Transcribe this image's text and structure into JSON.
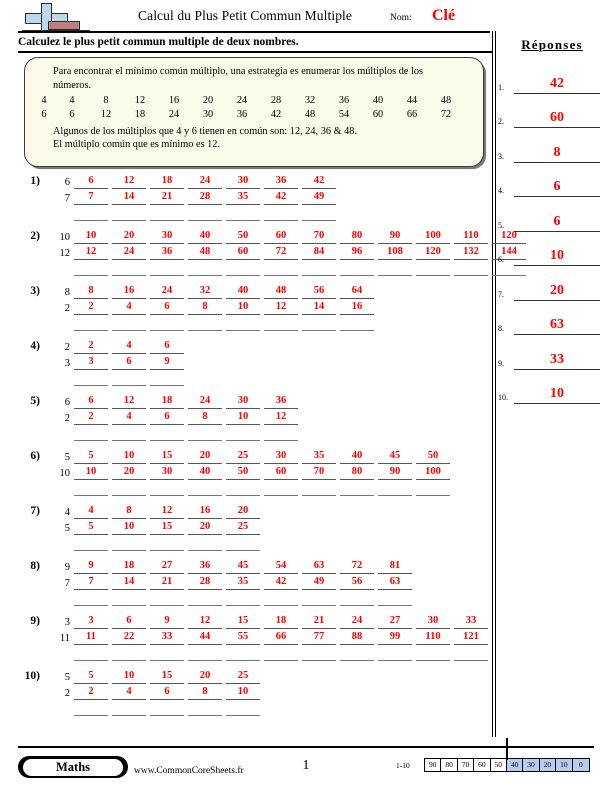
{
  "header": {
    "title": "Calcul du Plus Petit Commun Multiple",
    "name_label": "Nom:",
    "name_value": "Clé",
    "logo_icon": "plus-book-logo"
  },
  "instruction": "Calculez le plus petit commun multiple de deux nombres.",
  "example": {
    "line1": "Para encontrar el mínimo común múltiplo, una estrategia es enumerar los múltiplos de los números.",
    "row_a_lead": "4",
    "row_a": [
      "4",
      "8",
      "12",
      "16",
      "20",
      "24",
      "28",
      "32",
      "36",
      "40",
      "44",
      "48"
    ],
    "row_b_lead": "6",
    "row_b": [
      "6",
      "12",
      "18",
      "24",
      "30",
      "36",
      "42",
      "48",
      "54",
      "60",
      "66",
      "72"
    ],
    "conclusion1": "Algunos de los múltiplos que 4 y 6 tienen en común son: 12, 24, 36 & 48.",
    "conclusion2": "El múltiplo común que es mínimo es 12."
  },
  "problems": [
    {
      "number": "1)",
      "seed_a": "6",
      "multiples_a": [
        "6",
        "12",
        "18",
        "24",
        "30",
        "36",
        "42"
      ],
      "seed_b": "7",
      "multiples_b": [
        "7",
        "14",
        "21",
        "28",
        "35",
        "42",
        "49"
      ],
      "blank_count": 7
    },
    {
      "number": "2)",
      "seed_a": "10",
      "multiples_a": [
        "10",
        "20",
        "30",
        "40",
        "50",
        "60",
        "70",
        "80",
        "90",
        "100",
        "110",
        "120"
      ],
      "seed_b": "12",
      "multiples_b": [
        "12",
        "24",
        "36",
        "48",
        "60",
        "72",
        "84",
        "96",
        "108",
        "120",
        "132",
        "144"
      ],
      "blank_count": 12
    },
    {
      "number": "3)",
      "seed_a": "8",
      "multiples_a": [
        "8",
        "16",
        "24",
        "32",
        "40",
        "48",
        "56",
        "64"
      ],
      "seed_b": "2",
      "multiples_b": [
        "2",
        "4",
        "6",
        "8",
        "10",
        "12",
        "14",
        "16"
      ],
      "blank_count": 8
    },
    {
      "number": "4)",
      "seed_a": "2",
      "multiples_a": [
        "2",
        "4",
        "6"
      ],
      "seed_b": "3",
      "multiples_b": [
        "3",
        "6",
        "9"
      ],
      "blank_count": 3
    },
    {
      "number": "5)",
      "seed_a": "6",
      "multiples_a": [
        "6",
        "12",
        "18",
        "24",
        "30",
        "36"
      ],
      "seed_b": "2",
      "multiples_b": [
        "2",
        "4",
        "6",
        "8",
        "10",
        "12"
      ],
      "blank_count": 6
    },
    {
      "number": "6)",
      "seed_a": "5",
      "multiples_a": [
        "5",
        "10",
        "15",
        "20",
        "25",
        "30",
        "35",
        "40",
        "45",
        "50"
      ],
      "seed_b": "10",
      "multiples_b": [
        "10",
        "20",
        "30",
        "40",
        "50",
        "60",
        "70",
        "80",
        "90",
        "100"
      ],
      "blank_count": 10
    },
    {
      "number": "7)",
      "seed_a": "4",
      "multiples_a": [
        "4",
        "8",
        "12",
        "16",
        "20"
      ],
      "seed_b": "5",
      "multiples_b": [
        "5",
        "10",
        "15",
        "20",
        "25"
      ],
      "blank_count": 5
    },
    {
      "number": "8)",
      "seed_a": "9",
      "multiples_a": [
        "9",
        "18",
        "27",
        "36",
        "45",
        "54",
        "63",
        "72",
        "81"
      ],
      "seed_b": "7",
      "multiples_b": [
        "7",
        "14",
        "21",
        "28",
        "35",
        "42",
        "49",
        "56",
        "63"
      ],
      "blank_count": 9
    },
    {
      "number": "9)",
      "seed_a": "3",
      "multiples_a": [
        "3",
        "6",
        "9",
        "12",
        "15",
        "18",
        "21",
        "24",
        "27",
        "30",
        "33"
      ],
      "seed_b": "11",
      "multiples_b": [
        "11",
        "22",
        "33",
        "44",
        "55",
        "66",
        "77",
        "88",
        "99",
        "110",
        "121"
      ],
      "blank_count": 11
    },
    {
      "number": "10)",
      "seed_a": "5",
      "multiples_a": [
        "5",
        "10",
        "15",
        "20",
        "25"
      ],
      "seed_b": "2",
      "multiples_b": [
        "2",
        "4",
        "6",
        "8",
        "10"
      ],
      "blank_count": 5
    }
  ],
  "answers": {
    "title": "Réponses",
    "items": [
      {
        "index": "1.",
        "value": "42"
      },
      {
        "index": "2.",
        "value": "60"
      },
      {
        "index": "3.",
        "value": "8"
      },
      {
        "index": "4.",
        "value": "6"
      },
      {
        "index": "5.",
        "value": "6"
      },
      {
        "index": "6.",
        "value": "10"
      },
      {
        "index": "7.",
        "value": "20"
      },
      {
        "index": "8.",
        "value": "63"
      },
      {
        "index": "9.",
        "value": "33"
      },
      {
        "index": "10.",
        "value": "10"
      }
    ]
  },
  "footer": {
    "brand": "Maths",
    "site": "www.CommonCoreSheets.fr",
    "page_number": "1",
    "scale_label": "1-10",
    "scale_cells": [
      {
        "value": "90",
        "highlighted": false
      },
      {
        "value": "80",
        "highlighted": false
      },
      {
        "value": "70",
        "highlighted": false
      },
      {
        "value": "60",
        "highlighted": false
      },
      {
        "value": "50",
        "highlighted": false
      },
      {
        "value": "40",
        "highlighted": true
      },
      {
        "value": "30",
        "highlighted": true
      },
      {
        "value": "20",
        "highlighted": true
      },
      {
        "value": "10",
        "highlighted": true
      },
      {
        "value": "0",
        "highlighted": true
      }
    ]
  },
  "colors": {
    "answer_red": "#ff0000",
    "box_background": "#fbfbe9",
    "scale_highlight": "#b6ccf0",
    "logo_blue": "#bcd8ea",
    "logo_red": "#c08080"
  }
}
